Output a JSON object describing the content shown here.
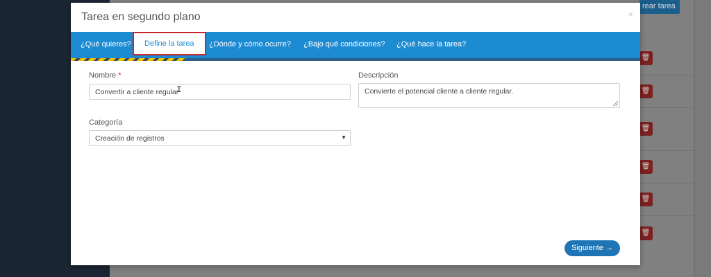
{
  "background": {
    "create_button_label": "rear tarea",
    "delete_icon_glyph": "🗑"
  },
  "modal": {
    "title": "Tarea en segundo plano",
    "close_glyph": "×",
    "tabs": [
      {
        "label": "¿Qué quieres?"
      },
      {
        "label": "Define la tarea"
      },
      {
        "label": "¿Dónde y cómo ocurre?"
      },
      {
        "label": "¿Bajo qué condiciones?"
      },
      {
        "label": "¿Qué hace la tarea?"
      }
    ],
    "active_tab": "Define la tarea",
    "progress_fraction": 0.2,
    "form": {
      "nombre_label": "Nombre",
      "required_mark": "*",
      "nombre_value": "Convertir a cliente regular",
      "descripcion_label": "Descripción",
      "descripcion_value": "Convierte el potencial cliente a cliente regular.",
      "categoria_label": "Categoría",
      "categoria_value": "Creación de registros",
      "select_arrow_glyph": "▼"
    },
    "next_button_label": "Siguiente →"
  },
  "colors": {
    "tab_bar": "#1d8bd2",
    "active_tab_border": "#c9252c",
    "primary_button": "#1f75b5",
    "progress_stripe": "#f2c200"
  }
}
